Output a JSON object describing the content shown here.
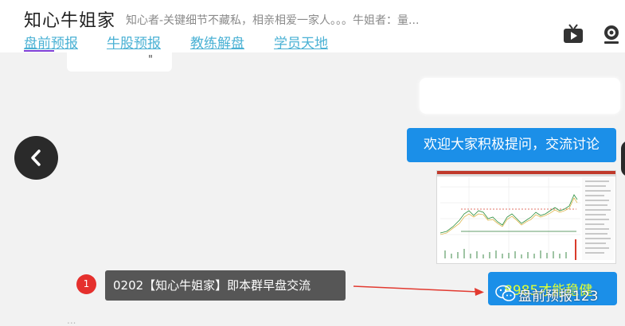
{
  "header": {
    "title": "知心牛姐家",
    "description": "知心者-关键细节不藏私，相亲相爱一家人。。。牛姐者：量..."
  },
  "nav": {
    "items": [
      "盘前预报",
      "牛股预报",
      "教练解盘",
      "学员天地"
    ],
    "active": "盘前预报",
    "accent_color": "#7d3fd6",
    "link_color": "#4ab1d4"
  },
  "header_icons": [
    "tv-icon",
    "live-camera-icon"
  ],
  "chat": {
    "top_left_fragment": "\"",
    "blue_bubble_1": "欢迎大家积极提问，交流讨论",
    "blue_bubble_2": "8985才能稳健",
    "bubble_color": "#1b8fe8"
  },
  "watermark": {
    "label": "盘前预报123",
    "icon": "wechat-icon"
  },
  "tooltip": {
    "badge": "1",
    "text": "0202【知心牛姐家】即本群早盘交流",
    "badge_color": "#e5302d"
  },
  "nav_buttons": {
    "back": "chevron-left-icon"
  },
  "bottom_faint": "..."
}
